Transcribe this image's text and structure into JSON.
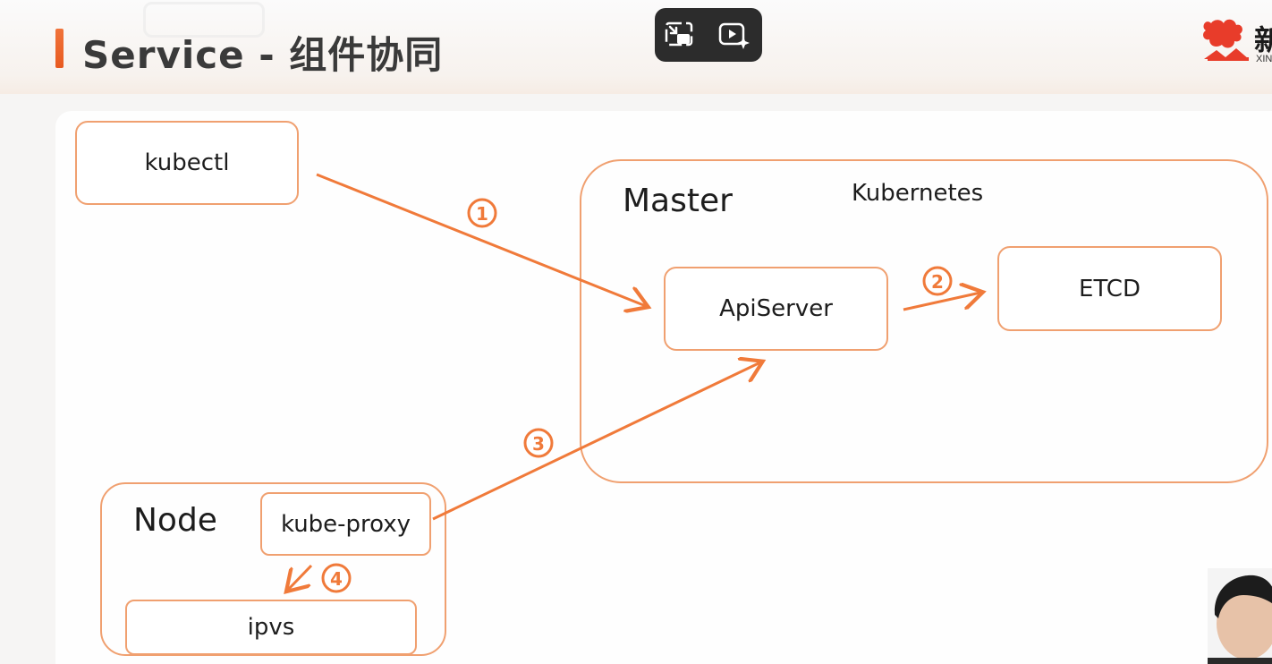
{
  "header": {
    "title": "Service - 组件协同",
    "logo_char": "新",
    "logo_sub": "XIN"
  },
  "video_controls": {
    "icons": [
      "picture-in-picture-exit-icon",
      "video-ai-icon"
    ]
  },
  "diagram": {
    "kubectl_label": "kubectl",
    "master_label": "Master",
    "kubernetes_label": "Kubernetes",
    "apiserver_label": "ApiServer",
    "etcd_label": "ETCD",
    "node_label": "Node",
    "kube_proxy_label": "kube-proxy",
    "ipvs_label": "ipvs",
    "steps": [
      "①",
      "②",
      "③",
      "④"
    ],
    "accent_color": "#f07a3a",
    "border_color": "#f0a070"
  }
}
